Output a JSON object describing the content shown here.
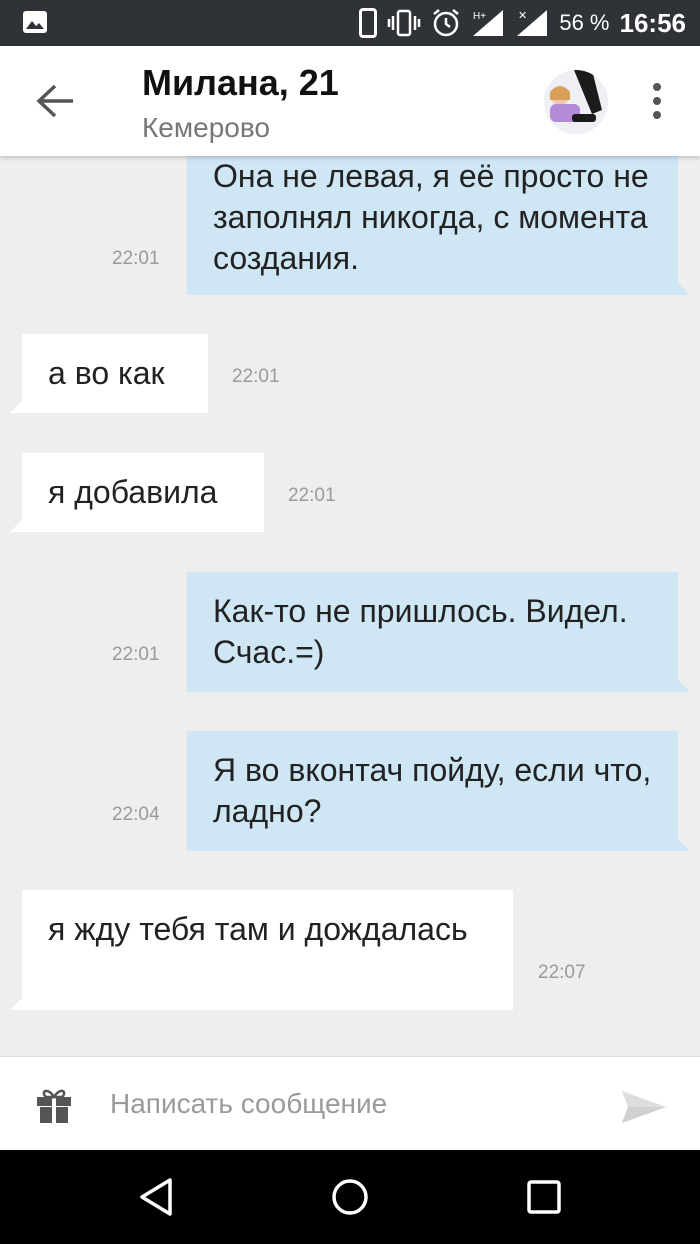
{
  "status_bar": {
    "battery": "56 %",
    "time": "16:56"
  },
  "header": {
    "title": "Милана, 21",
    "subtitle": "Кемерово"
  },
  "messages": [
    {
      "direction": "outgoing",
      "text": "Она не левая, я её просто не заполнял никогда, с момента создания.",
      "time": "22:01"
    },
    {
      "direction": "incoming",
      "text": "а во как",
      "time": "22:01"
    },
    {
      "direction": "incoming",
      "text": "я добавила",
      "time": "22:01"
    },
    {
      "direction": "outgoing",
      "text": "Как-то не пришлось. Видел. Счас.=)",
      "time": "22:01"
    },
    {
      "direction": "outgoing",
      "text": "Я во вконтач пойду, если что, ладно?",
      "time": "22:04"
    },
    {
      "direction": "incoming",
      "text": "я жду тебя там и дождалась",
      "time": "22:07"
    }
  ],
  "composer": {
    "placeholder": "Написать сообщение"
  },
  "icons": {
    "gallery": "image-icon",
    "phone": "phone-icon",
    "vibrate": "vibrate-icon",
    "alarm": "alarm-icon",
    "signal": "signal-icon",
    "back": "arrow-left-icon",
    "more": "more-vert-icon",
    "gift": "gift-icon",
    "send": "send-icon"
  },
  "colors": {
    "outgoing_bubble": "#cfe6f5",
    "incoming_bubble": "#ffffff",
    "background": "#eeeeee"
  }
}
